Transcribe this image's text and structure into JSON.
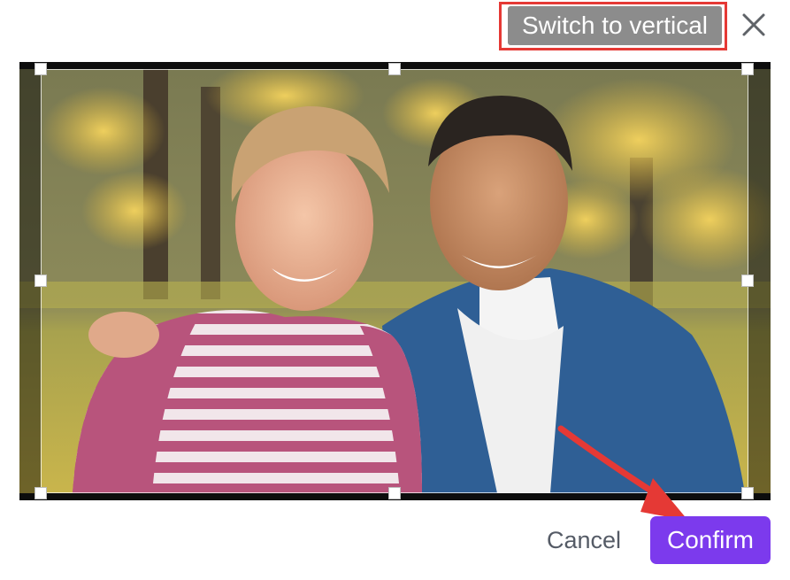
{
  "header": {
    "switch_label": "Switch to vertical",
    "close_icon": "close-icon"
  },
  "footer": {
    "cancel_label": "Cancel",
    "confirm_label": "Confirm"
  },
  "colors": {
    "accent": "#7c3aed",
    "switch_bg": "#8c8c8c",
    "annotation": "#e53935"
  },
  "icons": [
    "close-icon",
    "arrow-annotation-icon"
  ]
}
